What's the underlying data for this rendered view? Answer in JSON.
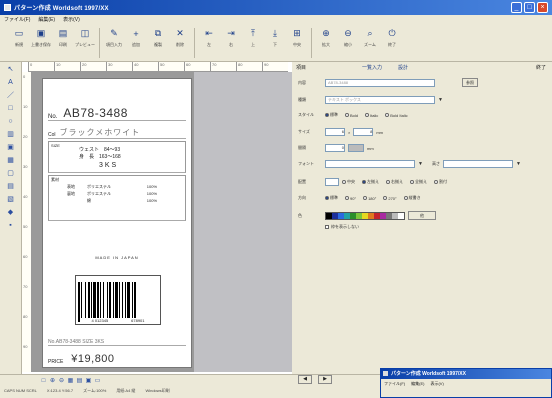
{
  "window": {
    "title": "パターン作成 Worldsoft 1997/XX"
  },
  "menu": [
    "ファイル(F)",
    "編集(E)",
    "表示(V)"
  ],
  "toolbar": [
    {
      "label": "新規",
      "icon": "new-icon"
    },
    {
      "label": "上書き保存",
      "icon": "save-icon"
    },
    {
      "label": "印刷",
      "icon": "print-icon"
    },
    {
      "label": "プレビュー",
      "icon": "preview-icon"
    },
    {
      "label": "項目入力",
      "icon": "input-icon"
    },
    {
      "label": "追加",
      "icon": "add-icon"
    },
    {
      "label": "複製",
      "icon": "copy-icon"
    },
    {
      "label": "削除",
      "icon": "delete-icon"
    },
    {
      "label": "左",
      "icon": "align-left-icon"
    },
    {
      "label": "右",
      "icon": "align-right-icon"
    },
    {
      "label": "上",
      "icon": "align-top-icon"
    },
    {
      "label": "下",
      "icon": "align-bottom-icon"
    },
    {
      "label": "中央",
      "icon": "center-icon"
    },
    {
      "label": "拡大",
      "icon": "zoom-in-icon"
    },
    {
      "label": "縮小",
      "icon": "zoom-out-icon"
    },
    {
      "label": "ズーム",
      "icon": "zoom-icon"
    },
    {
      "label": "終了",
      "icon": "exit-icon"
    }
  ],
  "ruler_marks": [
    "0",
    "10",
    "20",
    "30",
    "40",
    "50",
    "60",
    "70",
    "80",
    "90"
  ],
  "label": {
    "no_prefix": "No.",
    "no_value": "AB78-3488",
    "color_prefix": "Col",
    "color_value": "ブラックメホワイト",
    "size_caption": "SIZE",
    "size_line1": "ウェスト　84〜93",
    "size_line2": "身　長　163〜168",
    "size_value": "3KS",
    "fiber_caption": "素材",
    "fiber_rows": [
      [
        "表地",
        "ポリエステル",
        "100%"
      ],
      [
        "裏地",
        "ポリエステル",
        "100%"
      ],
      [
        "",
        "綿",
        "100%"
      ]
    ],
    "made_in": "MADE IN JAPAN",
    "barcode_digits": [
      "4 012345",
      "678901"
    ],
    "no2": "No.AB78-3488  SIZE  3KS",
    "price_caption": "PRICE",
    "price_value": "¥19,800"
  },
  "props": {
    "tab_list": "一覧入力",
    "tab_design": "設計",
    "right_label": "終了",
    "header_left": "項目",
    "rows": {
      "content_label": "内容",
      "content_value": "AB78-3488",
      "content_button": "参照",
      "kind_label": "種類",
      "kind_value": "テキスト ボックス",
      "style_label": "スタイル",
      "style_options": [
        "標準",
        "Bold",
        "Italic",
        "Bold Italic"
      ],
      "size_label": "サイズ",
      "size_value_w": "6",
      "size_value_h": "8",
      "size_unit": "mm",
      "spacing_label": "間隔",
      "spacing_value": "0",
      "spacing_unit": "mm",
      "font_label": "フォント",
      "font_value": "",
      "font_size_label": "高さ",
      "align_label": "配置",
      "align_options": [
        "中央",
        "左揃え",
        "右揃え",
        "全揃え",
        "割付"
      ],
      "dir_label": "方向",
      "dir_options": [
        "標準",
        "90°",
        "180°",
        "270°",
        "縦書き"
      ],
      "color_label": "色",
      "color_button": "他",
      "frame_label": "枠を表示しない"
    },
    "palette": [
      "#000000",
      "#1d2f9a",
      "#2b6ae0",
      "#21a3a3",
      "#2a8f2a",
      "#7cc63a",
      "#e6d822",
      "#e07a1e",
      "#c4232d",
      "#a82aa0",
      "#777777",
      "#bbbbbb",
      "#ffffff"
    ]
  },
  "status": {
    "items": [
      "CAPS NUM SCRL",
      "X:123.4 Y:56.7",
      "ズーム:100%",
      "用紙:A4 縦",
      "Windows印刷"
    ],
    "nav_prev": "◀",
    "nav_next": "▶"
  },
  "subwindow": {
    "title": "パターン作成 Worldsoft 1997/XX",
    "menu": [
      "ファイル(F)",
      "編集(E)",
      "表示(V)"
    ]
  }
}
